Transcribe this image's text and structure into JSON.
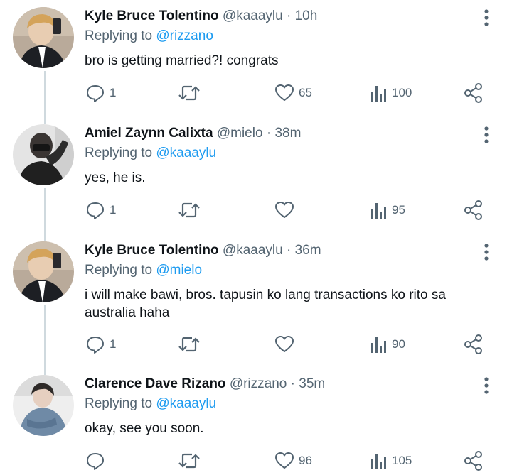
{
  "replies": [
    {
      "name": "Kyle Bruce Tolentino",
      "handle": "@kaaaylu",
      "time": "10h",
      "replying_label": "Replying to ",
      "replying_to": "@rizzano",
      "text": "bro is getting married?! congrats",
      "reply_count": "1",
      "retweet_count": "",
      "like_count": "65",
      "view_count": "100"
    },
    {
      "name": "Amiel Zaynn Calixta",
      "handle": "@mielo",
      "time": "38m",
      "replying_label": "Replying to ",
      "replying_to": "@kaaaylu",
      "text": "yes, he is.",
      "reply_count": "1",
      "retweet_count": "",
      "like_count": "",
      "view_count": "95"
    },
    {
      "name": "Kyle Bruce Tolentino",
      "handle": "@kaaaylu",
      "time": "36m",
      "replying_label": "Replying to ",
      "replying_to": "@mielo",
      "text": "i will make bawi, bros. tapusin ko lang transactions ko rito sa australia haha",
      "reply_count": "1",
      "retweet_count": "",
      "like_count": "",
      "view_count": "90"
    },
    {
      "name": "Clarence Dave Rizano",
      "handle": "@rizzano",
      "time": "35m",
      "replying_label": "Replying to ",
      "replying_to": "@kaaaylu",
      "text": "okay, see you soon.",
      "reply_count": "",
      "retweet_count": "",
      "like_count": "96",
      "view_count": "105"
    }
  ],
  "separator": " · ",
  "colors": {
    "text_primary": "#0f1419",
    "text_secondary": "#536471",
    "mention": "#1d9bf0",
    "thread_line": "#cfd9de"
  },
  "icons": {
    "reply": "reply-icon",
    "retweet": "retweet-icon",
    "like": "heart-icon",
    "views": "views-icon",
    "share": "share-icon",
    "more": "more-options-icon"
  }
}
